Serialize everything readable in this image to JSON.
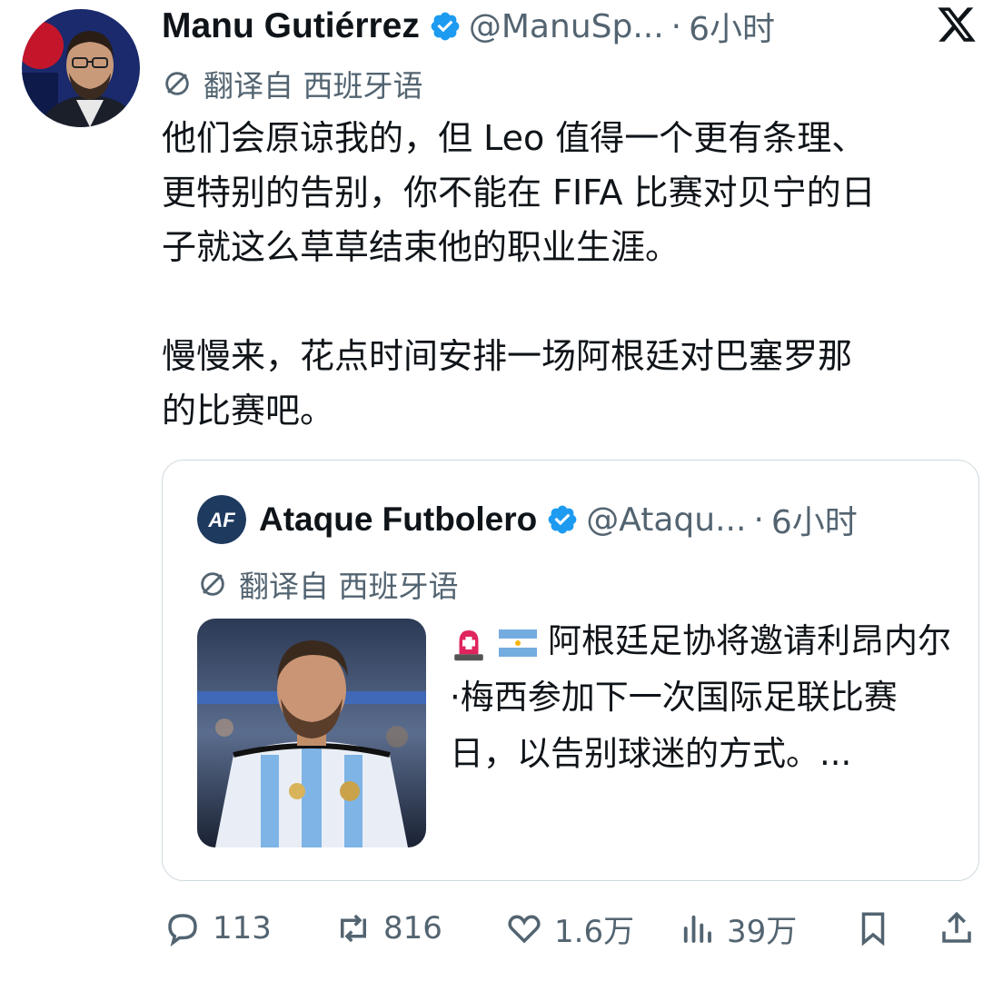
{
  "tweet": {
    "author_name": "Manu Gutiérrez",
    "author_handle": "@ManuSp...",
    "separator": "·",
    "time": "6小时",
    "translated_from": "翻译自 西班牙语",
    "text": "他们会原谅我的，但 Leo 值得一个更有条理、\n更特别的告别，你不能在 FIFA 比赛对贝宁的日\n子就这么草草结束他的职业生涯。\n\n慢慢来，花点时间安排一场阿根廷对巴塞罗那\n的比赛吧。"
  },
  "quoted_tweet": {
    "author_name": "Ataque Futbolero",
    "author_handle": "@Ataqu...",
    "separator": "·",
    "time": "6小时",
    "translated_from": "翻译自 西班牙语",
    "text": "阿根廷足协将邀请利昂内尔·梅西参加下一次国际足联比赛日，以告别球迷的方式。..."
  },
  "actions": {
    "replies": "113",
    "reposts": "816",
    "likes": "1.6万",
    "views": "39万"
  },
  "icons": [
    "verified-badge-icon",
    "x-logo-icon",
    "translate-icon",
    "siren-icon",
    "argentina-flag-icon",
    "reply-icon",
    "repost-icon",
    "like-icon",
    "views-icon",
    "bookmark-icon",
    "share-icon"
  ],
  "colors": {
    "text": "#0f1419",
    "secondary": "#536471",
    "verified": "#1d9bf0",
    "border": "#cfd9de"
  }
}
